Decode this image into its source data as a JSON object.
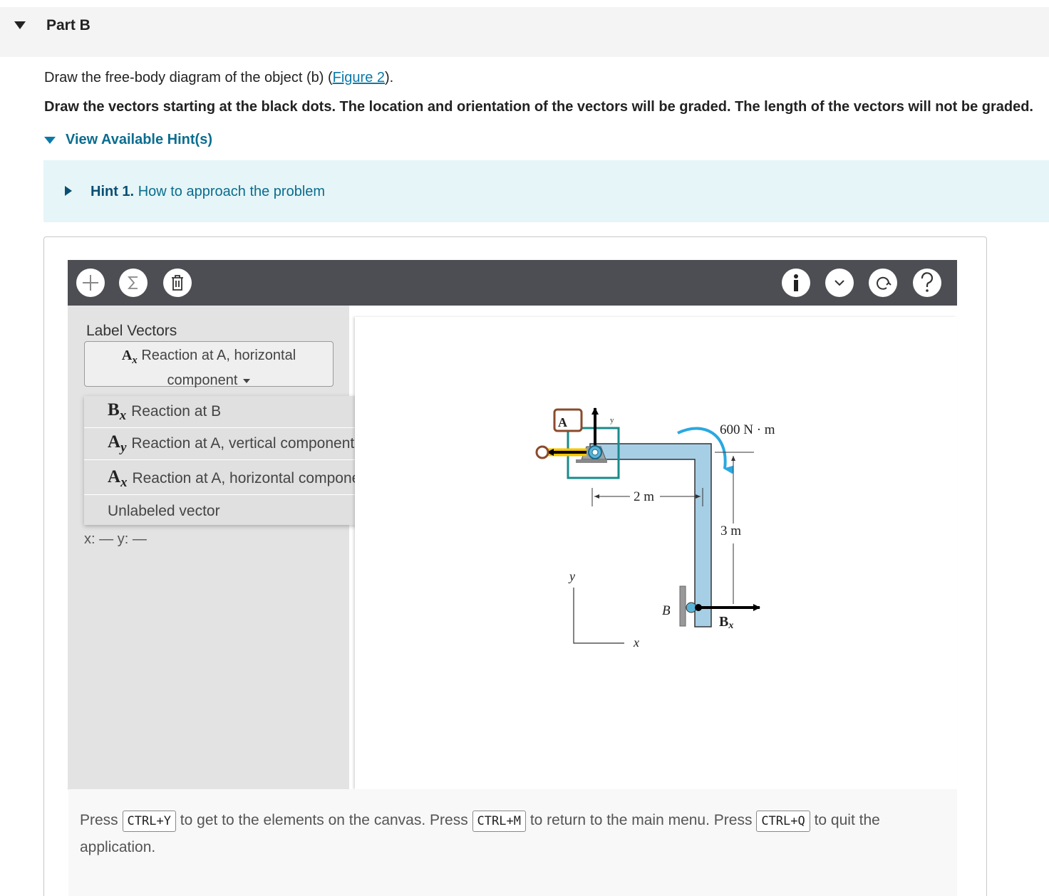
{
  "part": {
    "title": "Part B"
  },
  "question": {
    "prefix": "Draw the free-body diagram of the object (b) (",
    "link": "Figure 2",
    "suffix": ")."
  },
  "instructions": "Draw the vectors starting at the black dots. The location and orientation of the vectors will be graded. The length of the vectors will not be graded.",
  "hints": {
    "toggle_label": "View Available Hint(s)",
    "items": [
      {
        "number": "Hint 1.",
        "title": "How to approach the problem"
      }
    ]
  },
  "toolbar": {
    "left_icons": [
      "plus-icon",
      "sigma-icon",
      "trash-icon"
    ],
    "right_icons": [
      "info-icon",
      "chevron-down-icon",
      "reset-icon",
      "help-icon"
    ]
  },
  "label_vectors": {
    "title": "Label Vectors",
    "selected": {
      "symbol": "A",
      "subscript": "x",
      "text": "Reaction at A, horizontal component"
    },
    "options": [
      {
        "symbol": "B",
        "subscript": "x",
        "text": "Reaction at B"
      },
      {
        "symbol": "A",
        "subscript": "y",
        "text": "Reaction at A, vertical component"
      },
      {
        "symbol": "A",
        "subscript": "x",
        "text": "Reaction at A, horizontal component"
      },
      {
        "symbol": "",
        "subscript": "",
        "text": "Unlabeled vector"
      }
    ]
  },
  "coords": {
    "x_label": "x:",
    "x_value": "—",
    "y_label": "y:",
    "y_value": "—"
  },
  "figure": {
    "moment_label": "600 N · m",
    "dim_horizontal": "2 m",
    "dim_vertical": "3 m",
    "point_b": "B",
    "bx_symbol": "B",
    "bx_sub": "x",
    "ax_tag": "A",
    "axis_y": "y",
    "axis_x": "x",
    "colors": {
      "beam": "#a6cfe6",
      "moment_arrow": "#2aa8e0",
      "selected_box": "#1a8a8a",
      "label_tag": "#8b4a2b",
      "highlight": "#f5c400"
    }
  },
  "footer": {
    "p1": "Press",
    "k1": "CTRL+Y",
    "p2": "to get to the elements on the canvas. Press",
    "k2": "CTRL+M",
    "p3": "to return to the main menu. Press",
    "k3": "CTRL+Q",
    "p4": "to quit the application."
  }
}
